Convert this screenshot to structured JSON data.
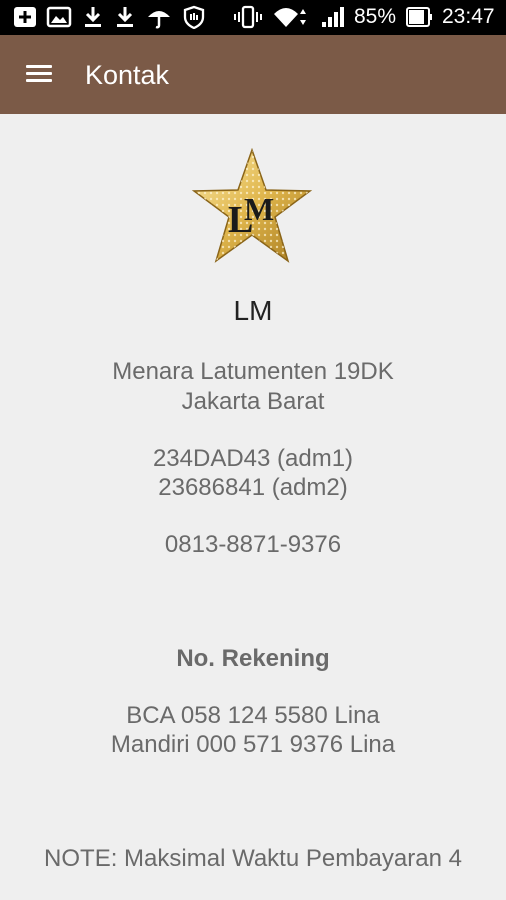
{
  "status_bar": {
    "battery_percent": "85%",
    "time": "23:47",
    "icons": [
      "add-box-icon",
      "image-icon",
      "download-icon",
      "download-icon",
      "umbrella-icon",
      "shield-hand-icon",
      "vibrate-icon",
      "wifi-icon",
      "signal-icon",
      "battery-icon"
    ]
  },
  "app_bar": {
    "title": "Kontak",
    "menu_icon": "hamburger-menu-icon",
    "background": "#7b5a47"
  },
  "contact": {
    "logo_text": "LM",
    "name": "LM",
    "address_line1": "Menara Latumenten 19DK",
    "address_line2": "Jakarta Barat",
    "pin1": "234DAD43 (adm1)",
    "pin2": "23686841 (adm2)",
    "phone": "0813-8871-9376",
    "account_heading": "No. Rekening",
    "account1": "BCA 058 124 5580 Lina",
    "account2": "Mandiri 000 571 9376 Lina",
    "note": "NOTE: Maksimal Waktu Pembayaran 4"
  }
}
